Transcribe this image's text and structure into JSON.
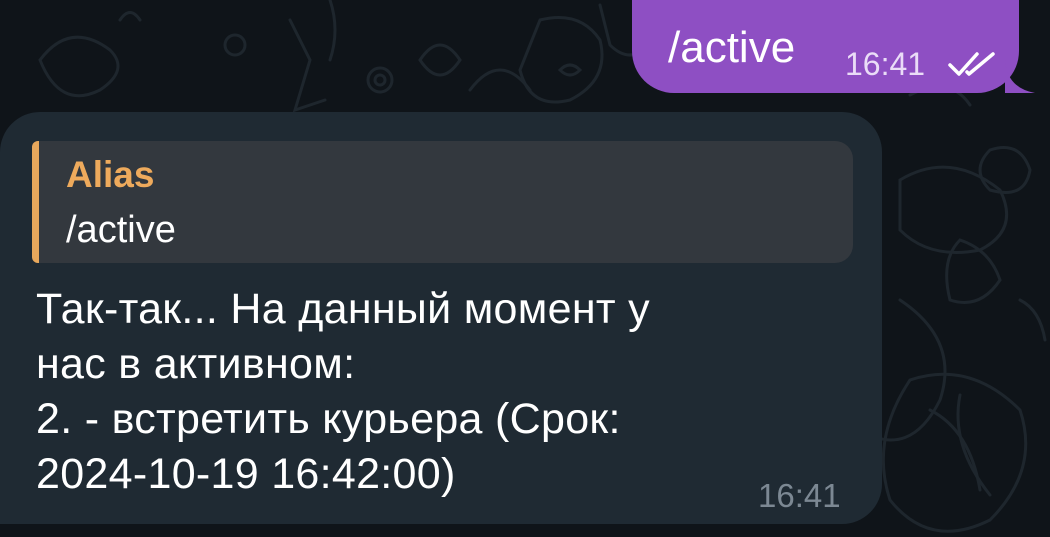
{
  "outgoing_message": {
    "text": "/active",
    "time": "16:41",
    "status_icon": "double-check-icon",
    "bubble_color": "#8e4fc3"
  },
  "incoming_message": {
    "reply": {
      "author": "Alias",
      "text": "/active",
      "author_color": "#eeaa5c",
      "accent_color": "#e8a85c"
    },
    "lines": [
      "Так-так... На данный момент у",
      "нас в активном:",
      "2. - встретить курьера (Срок:",
      "2024-10-19 16:42:00)"
    ],
    "time": "16:41",
    "bubble_color": "#1f2a33"
  },
  "wallpaper": {
    "background_color": "#0f1419"
  }
}
